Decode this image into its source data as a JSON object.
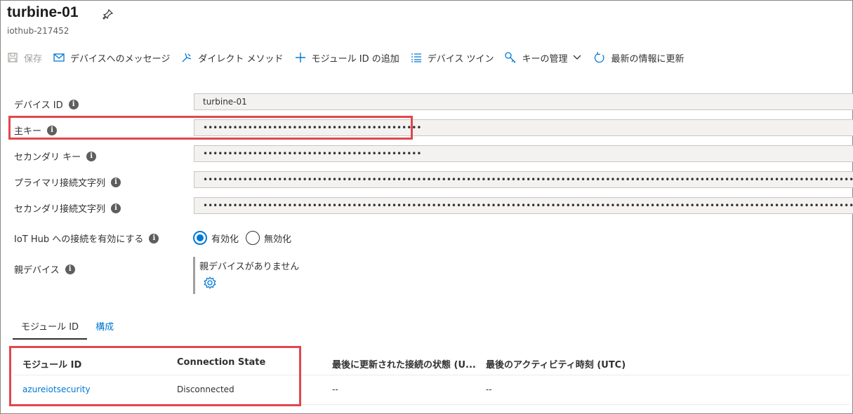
{
  "header": {
    "title": "turbine-01",
    "subtitle": "iothub-217452"
  },
  "toolbar": {
    "save": "保存",
    "message": "デバイスへのメッセージ",
    "direct_method": "ダイレクト メソッド",
    "add_module": "モジュール ID の追加",
    "device_twin": "デバイス ツイン",
    "manage_keys": "キーの管理",
    "refresh": "最新の情報に更新"
  },
  "fields": {
    "device_id": {
      "label": "デバイス ID",
      "value": "turbine-01"
    },
    "primary_key": {
      "label": "主キー",
      "value": "••••••••••••••••••••••••••••••••••••••••••••"
    },
    "secondary_key": {
      "label": "セカンダリ キー",
      "value": "••••••••••••••••••••••••••••••••••••••••••••"
    },
    "primary_conn": {
      "label": "プライマリ接続文字列",
      "value": "••••••••••••••••••••••••••••••••••••••••••••••••••••••••••••••••••••••••••••••••••••••••••••••••••••••••••••••••••••••••••••••••••••••••••"
    },
    "secondary_conn": {
      "label": "セカンダリ接続文字列",
      "value": "••••••••••••••••••••••••••••••••••••••••••••••••••••••••••••••••••••••••••••••••••••••••••••••••••••••••••••••••••••••••••••••••••••••••••"
    }
  },
  "connection": {
    "label": "IoT Hub への接続を有効にする",
    "enable": "有効化",
    "disable": "無効化",
    "selected": "enable"
  },
  "parent": {
    "label": "親デバイス",
    "none_text": "親デバイスがありません"
  },
  "tabs": [
    {
      "label": "モジュール ID",
      "active": true
    },
    {
      "label": "構成",
      "active": false
    }
  ],
  "table": {
    "headers": [
      "モジュール ID",
      "Connection State",
      "最後に更新された接続の状態 (U...",
      "最後のアクティビティ時刻 (UTC)"
    ],
    "rows": [
      [
        "azureiotsecurity",
        "Disconnected",
        "--",
        "--"
      ]
    ]
  },
  "colors": {
    "accent": "#0078d4",
    "highlight": "#e0474c"
  }
}
